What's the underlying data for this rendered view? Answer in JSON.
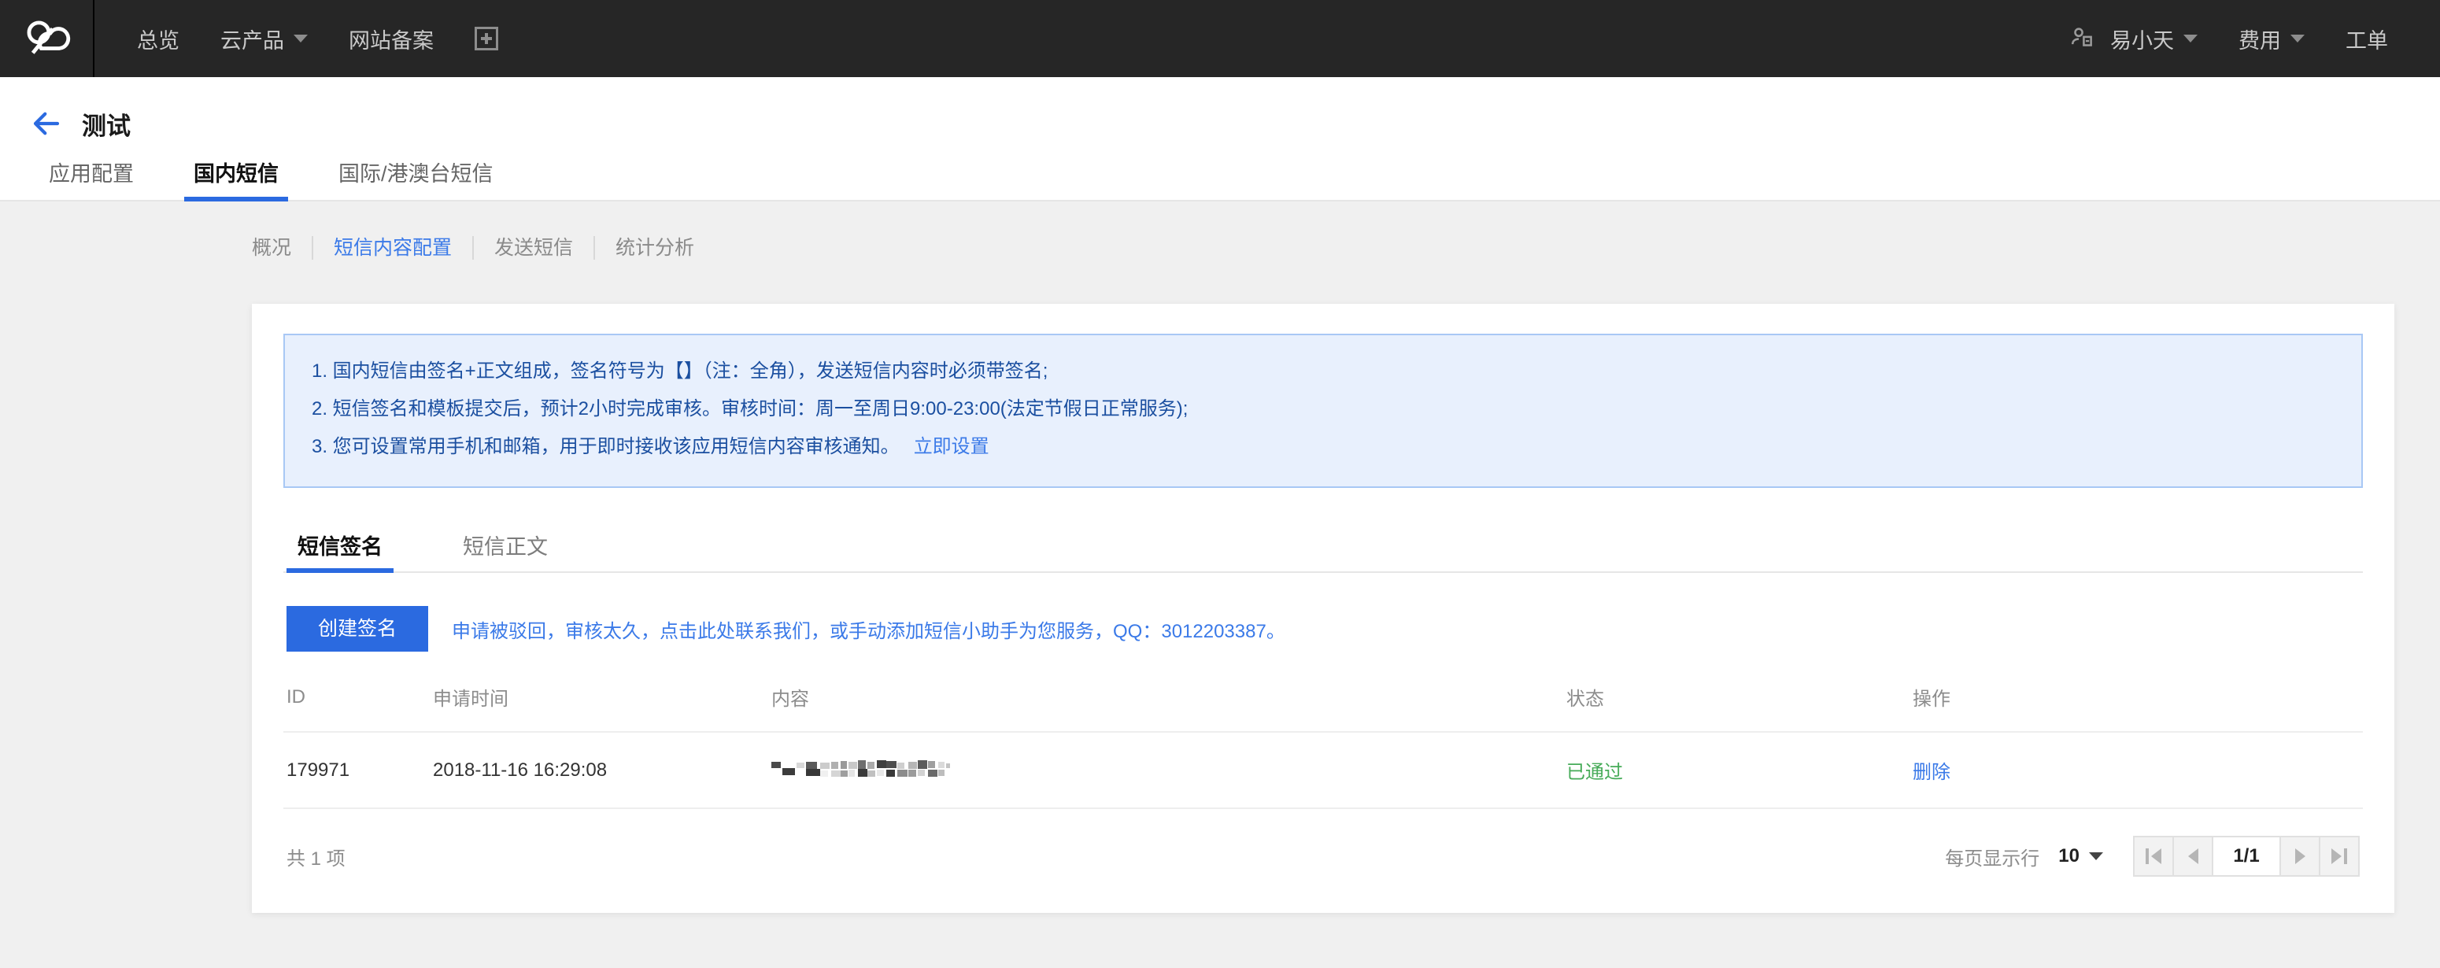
{
  "topbar": {
    "logo_icon": "cloud-logo-icon",
    "nav": [
      {
        "label": "总览",
        "has_caret": false
      },
      {
        "label": "云产品",
        "has_caret": true
      },
      {
        "label": "网站备案",
        "has_caret": false
      }
    ],
    "add_icon": "plus-square-icon",
    "user_icon": "user-icon",
    "user_name": "易小天",
    "billing": "费用",
    "tickets": "工单"
  },
  "page": {
    "back_icon": "back-arrow-icon",
    "title": "测试"
  },
  "main_tabs": [
    {
      "label": "应用配置",
      "active": false
    },
    {
      "label": "国内短信",
      "active": true
    },
    {
      "label": "国际/港澳台短信",
      "active": false
    }
  ],
  "subnav": [
    {
      "label": "概况",
      "active": false
    },
    {
      "label": "短信内容配置",
      "active": true
    },
    {
      "label": "发送短信",
      "active": false
    },
    {
      "label": "统计分析",
      "active": false
    }
  ],
  "notice": {
    "line1": "1. 国内短信由签名+正文组成，签名符号为【】（注：全角），发送短信内容时必须带签名;",
    "line2": "2. 短信签名和模板提交后，预计2小时完成审核。审核时间：周一至周日9:00-23:00(法定节假日正常服务);",
    "line3": "3. 您可设置常用手机和邮箱，用于即时接收该应用短信内容审核通知。",
    "line3_link": "立即设置"
  },
  "inner_tabs": [
    {
      "label": "短信签名",
      "active": true
    },
    {
      "label": "短信正文",
      "active": false
    }
  ],
  "actions": {
    "create_button": "创建签名",
    "hint": "申请被驳回，审核太久，点击此处联系我们，或手动添加短信小助手为您服务，QQ：3012203387。"
  },
  "table": {
    "headers": [
      "ID",
      "申请时间",
      "内容",
      "状态",
      "操作"
    ],
    "rows": [
      {
        "id": "179971",
        "time": "2018-11-16 16:29:08",
        "content": "",
        "content_redacted": "mosaic-redaction",
        "status": "已通过",
        "action": "删除"
      }
    ]
  },
  "footer": {
    "total": "共 1 项",
    "page_size_label": "每页显示行",
    "page_size": "10",
    "page_size_caret": "chevron-down-icon",
    "first_icon": "first-page-icon",
    "prev_icon": "prev-page-icon",
    "current_page": "1/1",
    "next_icon": "next-page-icon",
    "last_icon": "last-page-icon"
  },
  "colors": {
    "accent": "#2b6ae0",
    "link": "#3b7ae8",
    "success": "#46ab58",
    "topbar_bg": "#262626",
    "notice_bg": "#e8f0fd",
    "notice_border": "#a8c8f5"
  }
}
